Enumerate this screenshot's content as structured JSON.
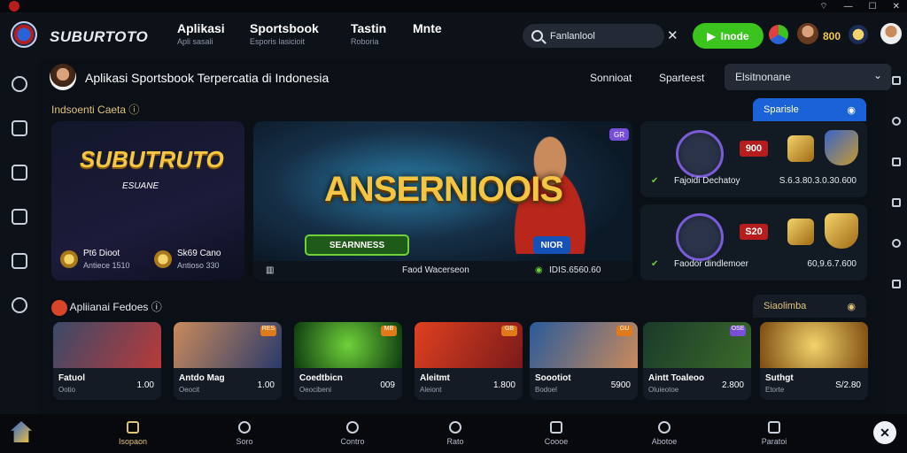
{
  "titlebar": {
    "controls": [
      "wifi-icon",
      "minimize",
      "maximize",
      "close"
    ]
  },
  "topnav": {
    "brand": "SUBURTOTO",
    "tabs": [
      {
        "label": "Aplikasi",
        "sub": "Apli sasali"
      },
      {
        "label": "Sportsbook",
        "sub": "Esporis lasicioit"
      },
      {
        "label": "Tastin",
        "sub": "Roboria"
      },
      {
        "label": "Mnte",
        "sub": ""
      }
    ],
    "search_value": "Fanlanlool",
    "cta_label": "Inode",
    "coins": "800"
  },
  "header": {
    "title": "Aplikasi Sportsbook Terpercatia di Indonesia",
    "link1": "Sonnioat",
    "link2": "Sparteest",
    "select_value": "Elsitnonane"
  },
  "featured": {
    "label": "Indsoenti Caeta",
    "tag": "Sparisle",
    "card1": {
      "logo": "SUBUTRUTO",
      "sub": "ESUANE",
      "item1_title": "Pt6 Dioot",
      "item1_sub": "Antiece 1510",
      "item2_title": "Sk69 Cano",
      "item2_sub": "Antioso 330"
    },
    "card2": {
      "title": "ANSERNIOOIS",
      "green_badge": "SEARNNESS",
      "blue_badge": "NIOR",
      "purple_badge": "GR",
      "footer_left": "Faod Wacerseon",
      "footer_right": "IDIS.6560.60"
    },
    "stats": [
      {
        "num": "900",
        "name": "Fajoidi Dechatoy",
        "val": "S.6.3.80.3.0.30.600"
      },
      {
        "num": "S20",
        "name": "Faodor dindlemoer",
        "val": "60,9.6.7.600"
      }
    ]
  },
  "popular": {
    "label": "Apliianai Fedoes",
    "tag": "Siaolimba",
    "games": [
      {
        "title": "Fatuol",
        "sub": "Ootio",
        "val": "1.00",
        "tag": ""
      },
      {
        "title": "Antdo Mag",
        "sub": "Oeocit",
        "val": "1.00",
        "tag": "RES"
      },
      {
        "title": "Coedtbicn",
        "sub": "Oeocibeni",
        "val": "009",
        "tag": "MB"
      },
      {
        "title": "Aleitmt",
        "sub": "Aleiont",
        "val": "1.800",
        "tag": "GB"
      },
      {
        "title": "Soootiot",
        "sub": "Bodoel",
        "val": "5900",
        "tag": "GU"
      },
      {
        "title": "Aintt Toaleoo",
        "sub": "Oluieotoe",
        "val": "2.800",
        "tag": "OSE"
      },
      {
        "title": "Suthgt",
        "sub": "Etorte",
        "val": "S/2.80",
        "tag": ""
      }
    ]
  },
  "bottomnav": [
    {
      "label": "Isopaon",
      "active": true
    },
    {
      "label": "Soro",
      "active": false
    },
    {
      "label": "Contro",
      "active": false
    },
    {
      "label": "Rato",
      "active": false
    },
    {
      "label": "Coooe",
      "active": false
    },
    {
      "label": "Abotoe",
      "active": false
    },
    {
      "label": "Paratoi",
      "active": false
    }
  ]
}
